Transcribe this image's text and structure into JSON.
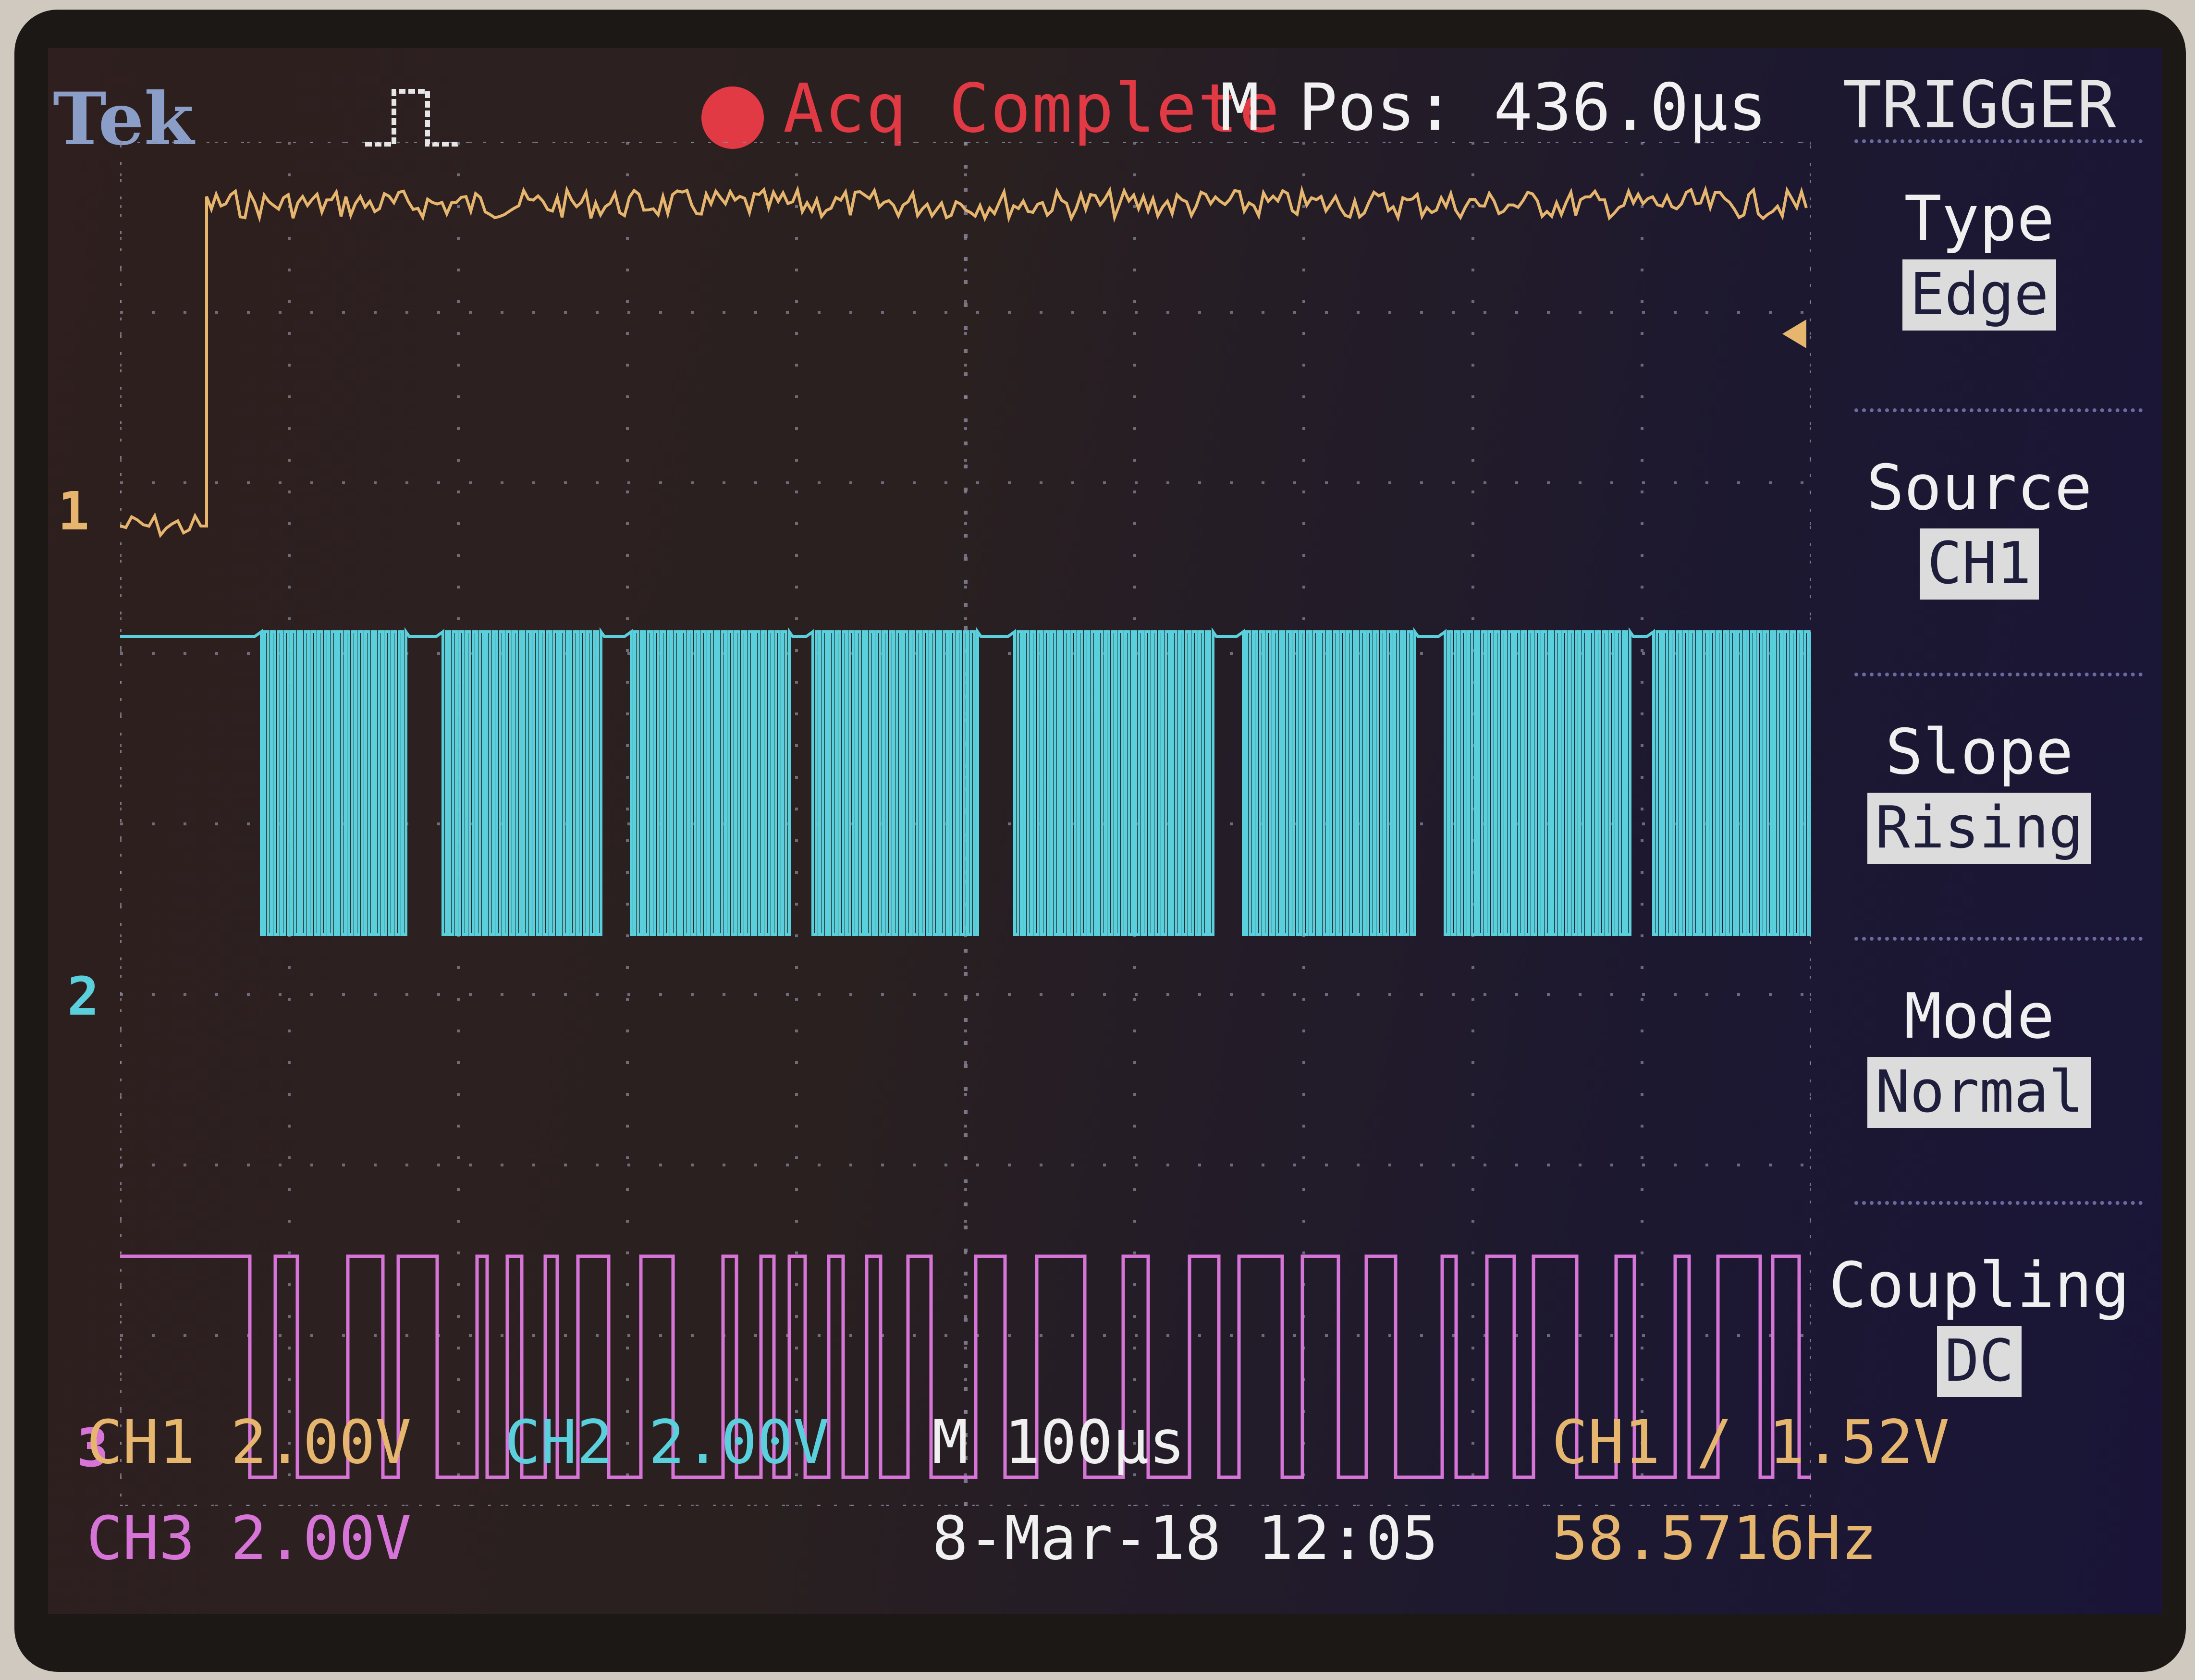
{
  "colors": {
    "ch1": "#e6b56e",
    "ch2": "#5ad0dc",
    "ch3": "#d774d8",
    "acq": "#e23a44",
    "grid": "#8c8ca0"
  },
  "header": {
    "brand": "Tek",
    "run_icon": "single-pulse-icon",
    "acq_status": "Acq Complete",
    "mpos": "M Pos: 436.0µs"
  },
  "menu": {
    "title": "TRIGGER",
    "items": [
      {
        "label": "Type",
        "value": "Edge"
      },
      {
        "label": "Source",
        "value": "CH1"
      },
      {
        "label": "Slope",
        "value": "Rising"
      },
      {
        "label": "Mode",
        "value": "Normal"
      },
      {
        "label": "Coupling",
        "value": "DC"
      }
    ]
  },
  "markers": {
    "ch1": "1",
    "ch2": "2",
    "ch3": "3"
  },
  "footer": {
    "ch1_name": "CH1",
    "ch1_scale": "2.00V",
    "ch2_name": "CH2",
    "ch2_scale": "2.00V",
    "ch3_name": "CH3",
    "ch3_scale": "2.00V",
    "timebase": "M 100µs",
    "datetime": "8-Mar-18 12:05",
    "trigger_readout": "CH1 / 1.52V",
    "frequency": "58.5716Hz"
  }
}
